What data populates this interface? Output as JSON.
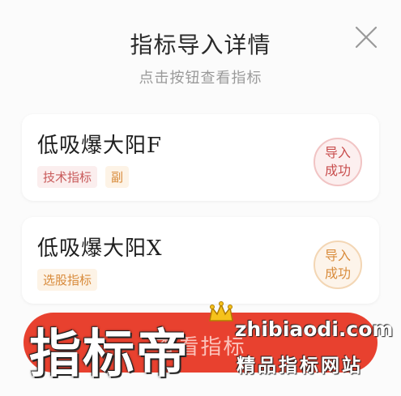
{
  "dialog": {
    "title": "指标导入详情",
    "subtitle": "点击按钮查看指标",
    "close_icon": "close-icon"
  },
  "items": [
    {
      "name": "低吸爆大阳F",
      "tags": [
        {
          "label": "技术指标",
          "color": "#c85a5a"
        },
        {
          "label": "副",
          "color": "#d88a3a"
        }
      ],
      "button_line1": "导入",
      "button_line2": "成功",
      "accent": "#c84e4e"
    },
    {
      "name": "低吸爆大阳X",
      "tags": [
        {
          "label": "选股指标",
          "color": "#d88a3a"
        }
      ],
      "button_line1": "导入",
      "button_line2": "成功",
      "accent": "#d98c3c"
    }
  ],
  "bottom_button": {
    "label": "查看指标",
    "color": "#e8412f"
  },
  "watermark": {
    "brand": "指标帝",
    "url": "zhibiaodi.com",
    "slogan": "精品指标网站"
  }
}
